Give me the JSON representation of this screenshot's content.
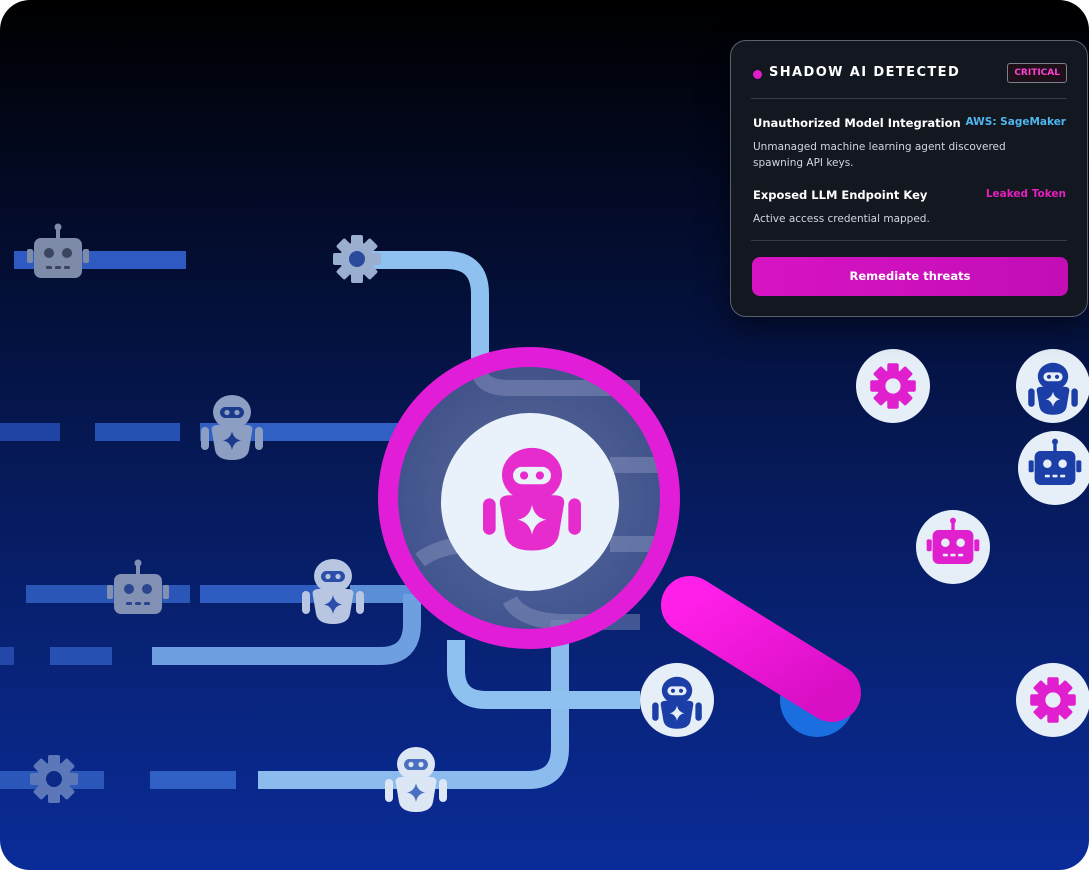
{
  "colors": {
    "accent": "#e01fcf",
    "lane": "#8ec1ef",
    "lane_faint": "#2a54b0",
    "card_bg": "#13171f",
    "aws_tag": "#4fb6f0",
    "leaked_tag": "#e61fbf"
  },
  "alert": {
    "title": "SHADOW AI DETECTED",
    "severity": "CRITICAL",
    "items": [
      {
        "title": "Unauthorized Model Integration",
        "tag": "AWS: SageMaker",
        "description": "Unmanaged machine learning agent discovered spawning API keys."
      },
      {
        "title": "Exposed LLM Endpoint Key",
        "tag": "Leaked Token",
        "description": "Active access credential mapped."
      }
    ],
    "action_label": "Remediate threats"
  },
  "icons": {
    "magnifier": "magnifier-icon",
    "agents": [
      "robot-head-icon",
      "robot-figure-icon",
      "gear-icon"
    ]
  }
}
